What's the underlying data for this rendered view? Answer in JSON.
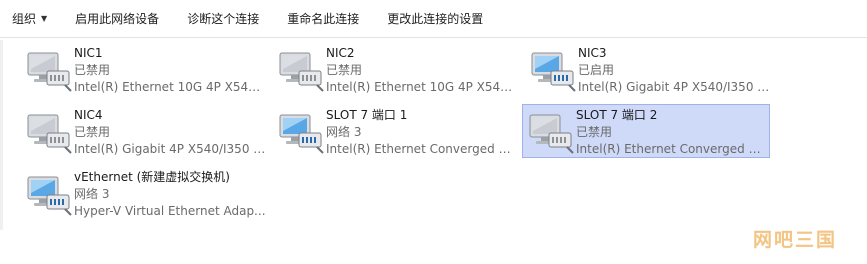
{
  "toolbar": {
    "items": [
      {
        "label": "组织",
        "has_dropdown": true
      },
      {
        "label": "启用此网络设备"
      },
      {
        "label": "诊断这个连接"
      },
      {
        "label": "重命名此连接"
      },
      {
        "label": "更改此连接的设置"
      }
    ]
  },
  "adapters": [
    {
      "name": "NIC1",
      "status": "已禁用",
      "device": "Intel(R) Ethernet 10G 4P X540/...",
      "icon": "network-adapter-disabled-icon"
    },
    {
      "name": "NIC2",
      "status": "已禁用",
      "device": "Intel(R) Ethernet 10G 4P X540/...",
      "icon": "network-adapter-disabled-icon"
    },
    {
      "name": "NIC3",
      "status": "已启用",
      "device": "Intel(R) Gigabit 4P X540/I350 r...",
      "icon": "network-adapter-icon"
    },
    {
      "name": "NIC4",
      "status": "已禁用",
      "device": "Intel(R) Gigabit 4P X540/I350 r...",
      "icon": "network-adapter-disabled-icon"
    },
    {
      "name": "SLOT 7 端口 1",
      "status": "网络 3",
      "device": "Intel(R) Ethernet Converged N...",
      "icon": "network-adapter-icon"
    },
    {
      "name": "SLOT 7 端口 2",
      "status": "已禁用",
      "device": "Intel(R) Ethernet Converged N...",
      "icon": "network-adapter-disabled-icon",
      "selected": true
    },
    {
      "name": "vEthernet (新建虚拟交换机)",
      "status": "网络 3",
      "device": "Hyper-V Virtual Ethernet Adap...",
      "icon": "network-adapter-icon"
    }
  ],
  "watermark": "网吧三国",
  "colors": {
    "selection_bg": "#cfd9f8",
    "selection_border": "#9fb2ea",
    "watermark": "#f3c483"
  }
}
